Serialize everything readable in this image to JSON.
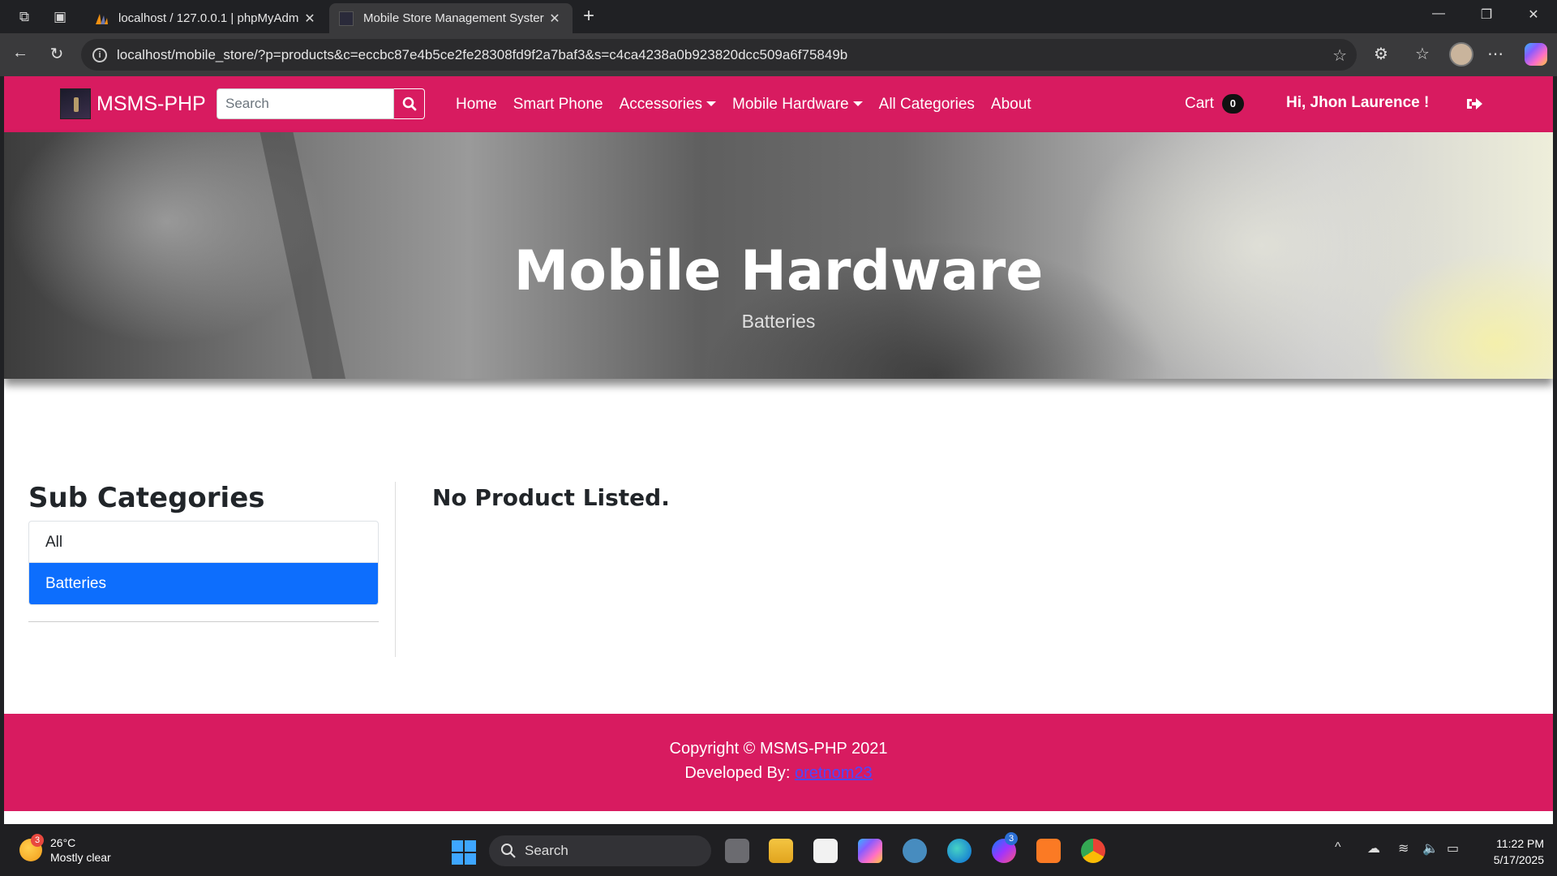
{
  "browser": {
    "tabs": [
      {
        "title": "localhost / 127.0.0.1 | phpMyAdm"
      },
      {
        "title": "Mobile Store Management Syster"
      }
    ],
    "url": "localhost/mobile_store/?p=products&c=eccbc87e4b5ce2fe28308fd9f2a7baf3&s=c4ca4238a0b923820dcc509a6f75849b"
  },
  "site": {
    "brand": "MSMS-PHP",
    "search_placeholder": "Search",
    "menu": [
      "Home",
      "Smart Phone",
      "Accessories",
      "Mobile Hardware",
      "All Categories",
      "About"
    ],
    "cart_label": "Cart",
    "cart_count": "0",
    "greeting": "Hi, Jhon Laurence !"
  },
  "hero": {
    "title": "Mobile Hardware",
    "subtitle": "Batteries"
  },
  "sidebar": {
    "heading": "Sub Categories",
    "items": [
      "All",
      "Batteries"
    ],
    "active_item": "Batteries"
  },
  "main": {
    "empty_message": "No Product Listed."
  },
  "footer": {
    "copyright": "Copyright © MSMS-PHP 2021",
    "developed_by_label": "Developed By:",
    "developer_link": "oretnom23"
  },
  "taskbar": {
    "weather_temp": "26°C",
    "weather_desc": "Mostly clear",
    "weather_badge": "3",
    "search_label": "Search",
    "messenger_badge": "3",
    "time": "11:22 PM",
    "date": "5/17/2025"
  },
  "colors": {
    "primary": "#d81b60",
    "active_item": "#0d6efd",
    "link": "#4b49ff"
  }
}
